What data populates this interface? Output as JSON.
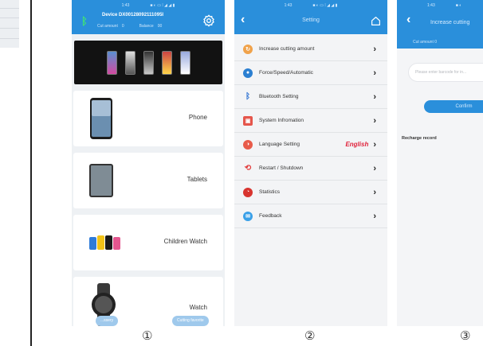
{
  "screen1": {
    "device_title": "Device DX00128092111095I",
    "cut_amount_label": "Cut amount",
    "cut_amount_value": "0",
    "balance_label": "Balance",
    "balance_value": "00",
    "categories": [
      {
        "label": "Phone"
      },
      {
        "label": "Tablets"
      },
      {
        "label": "Children Watch"
      },
      {
        "label": "Watch"
      }
    ],
    "chips": [
      "...ssery",
      "Cutting favorite"
    ],
    "marker": "①"
  },
  "screen2": {
    "title": "Setting",
    "menu": [
      {
        "label": "Increase cutting amount",
        "icon": "cutting-amount-icon",
        "color": "#f0a24a"
      },
      {
        "label": "Force/Speed/Automatic",
        "icon": "force-speed-icon",
        "color": "#2b7fd1"
      },
      {
        "label": "Bluetooth Setting",
        "icon": "bluetooth-icon",
        "color": "#2a6fd1"
      },
      {
        "label": "System Infromation",
        "icon": "system-info-icon",
        "color": "#e5564c"
      },
      {
        "label": "Language Setting",
        "icon": "language-icon",
        "color": "#e85b4a",
        "value": "English"
      },
      {
        "label": "Restart / Shutdown",
        "icon": "restart-icon",
        "color": "#e23a3a"
      },
      {
        "label": "Statistics",
        "icon": "statistics-icon",
        "color": "#d8342f"
      },
      {
        "label": "Feedback",
        "icon": "feedback-icon",
        "color": "#3aa0e8"
      }
    ],
    "marker": "②"
  },
  "screen3": {
    "title": "Increase cutting",
    "cut_amount": "Cut amount 0",
    "input_placeholder": "Please enter barcode for in...",
    "confirm_label": "Confirm",
    "record_label": "Recharge record",
    "marker": "③"
  },
  "colors": {
    "header_blue": "#2a8fdb",
    "language_value_red": "#e0213a"
  }
}
